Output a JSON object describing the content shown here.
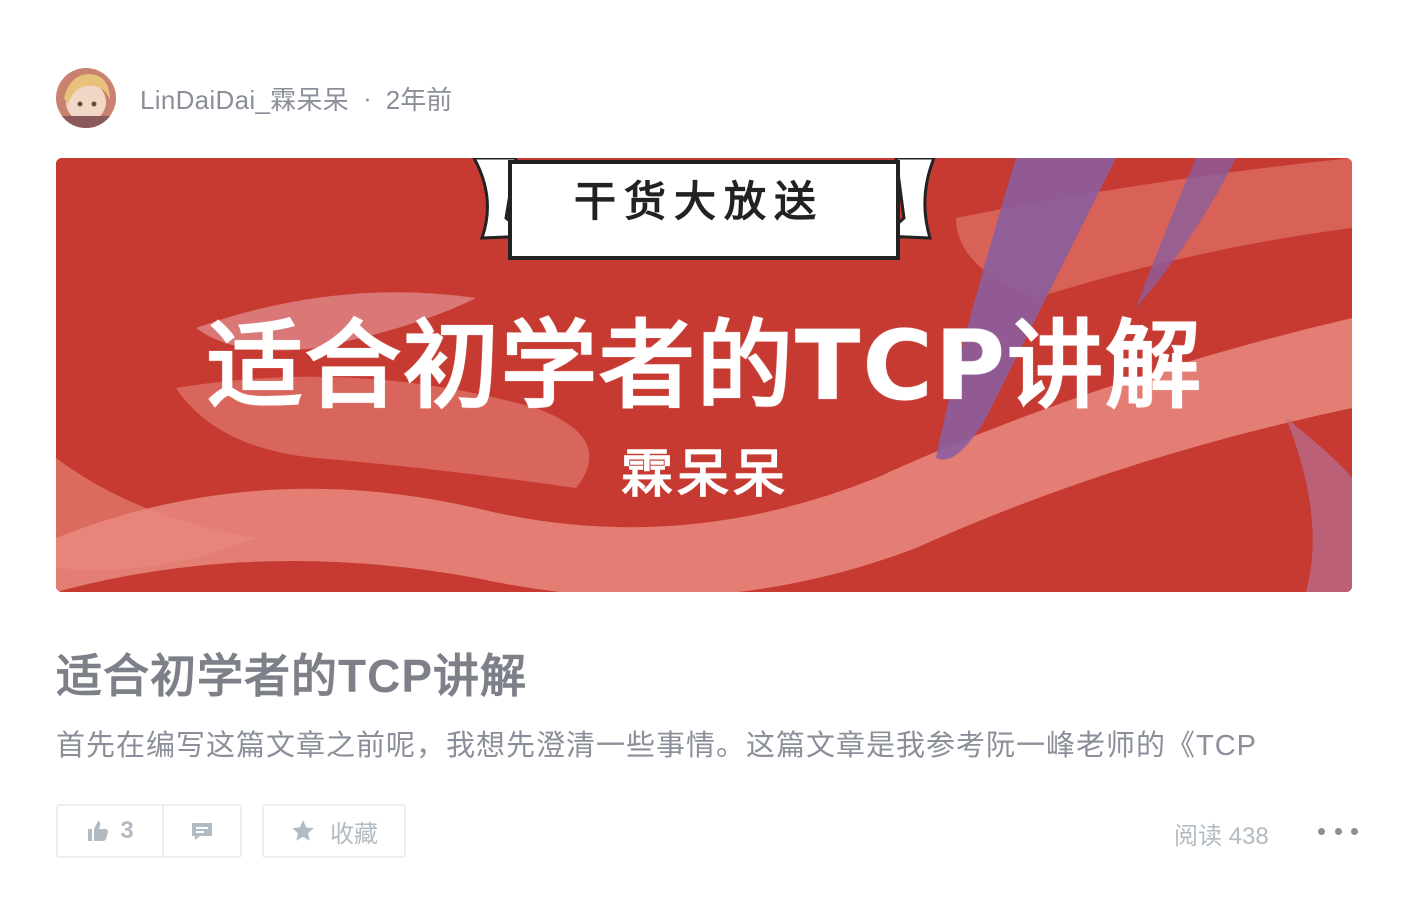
{
  "author": {
    "name": "LinDaiDai_霖呆呆",
    "separator": "·",
    "time": "2年前"
  },
  "cover": {
    "tag": "干货大放送",
    "title": "适合初学者的TCP讲解",
    "author": "霖呆呆",
    "colors": {
      "background": "#c63a31",
      "stroke_pink": "#e98a7f",
      "stroke_purple": "#8b5e9e"
    }
  },
  "article": {
    "title": "适合初学者的TCP讲解",
    "excerpt": "首先在编写这篇文章之前呢，我想先澄清一些事情。这篇文章是我参考阮一峰老师的《TCP"
  },
  "actions": {
    "like_icon": "thumbs-up-icon",
    "like_count": "3",
    "comment_icon": "comment-icon",
    "collect_icon": "star-icon",
    "collect_label": "收藏",
    "read_count": "阅读 438",
    "more_icon": "more-icon"
  }
}
